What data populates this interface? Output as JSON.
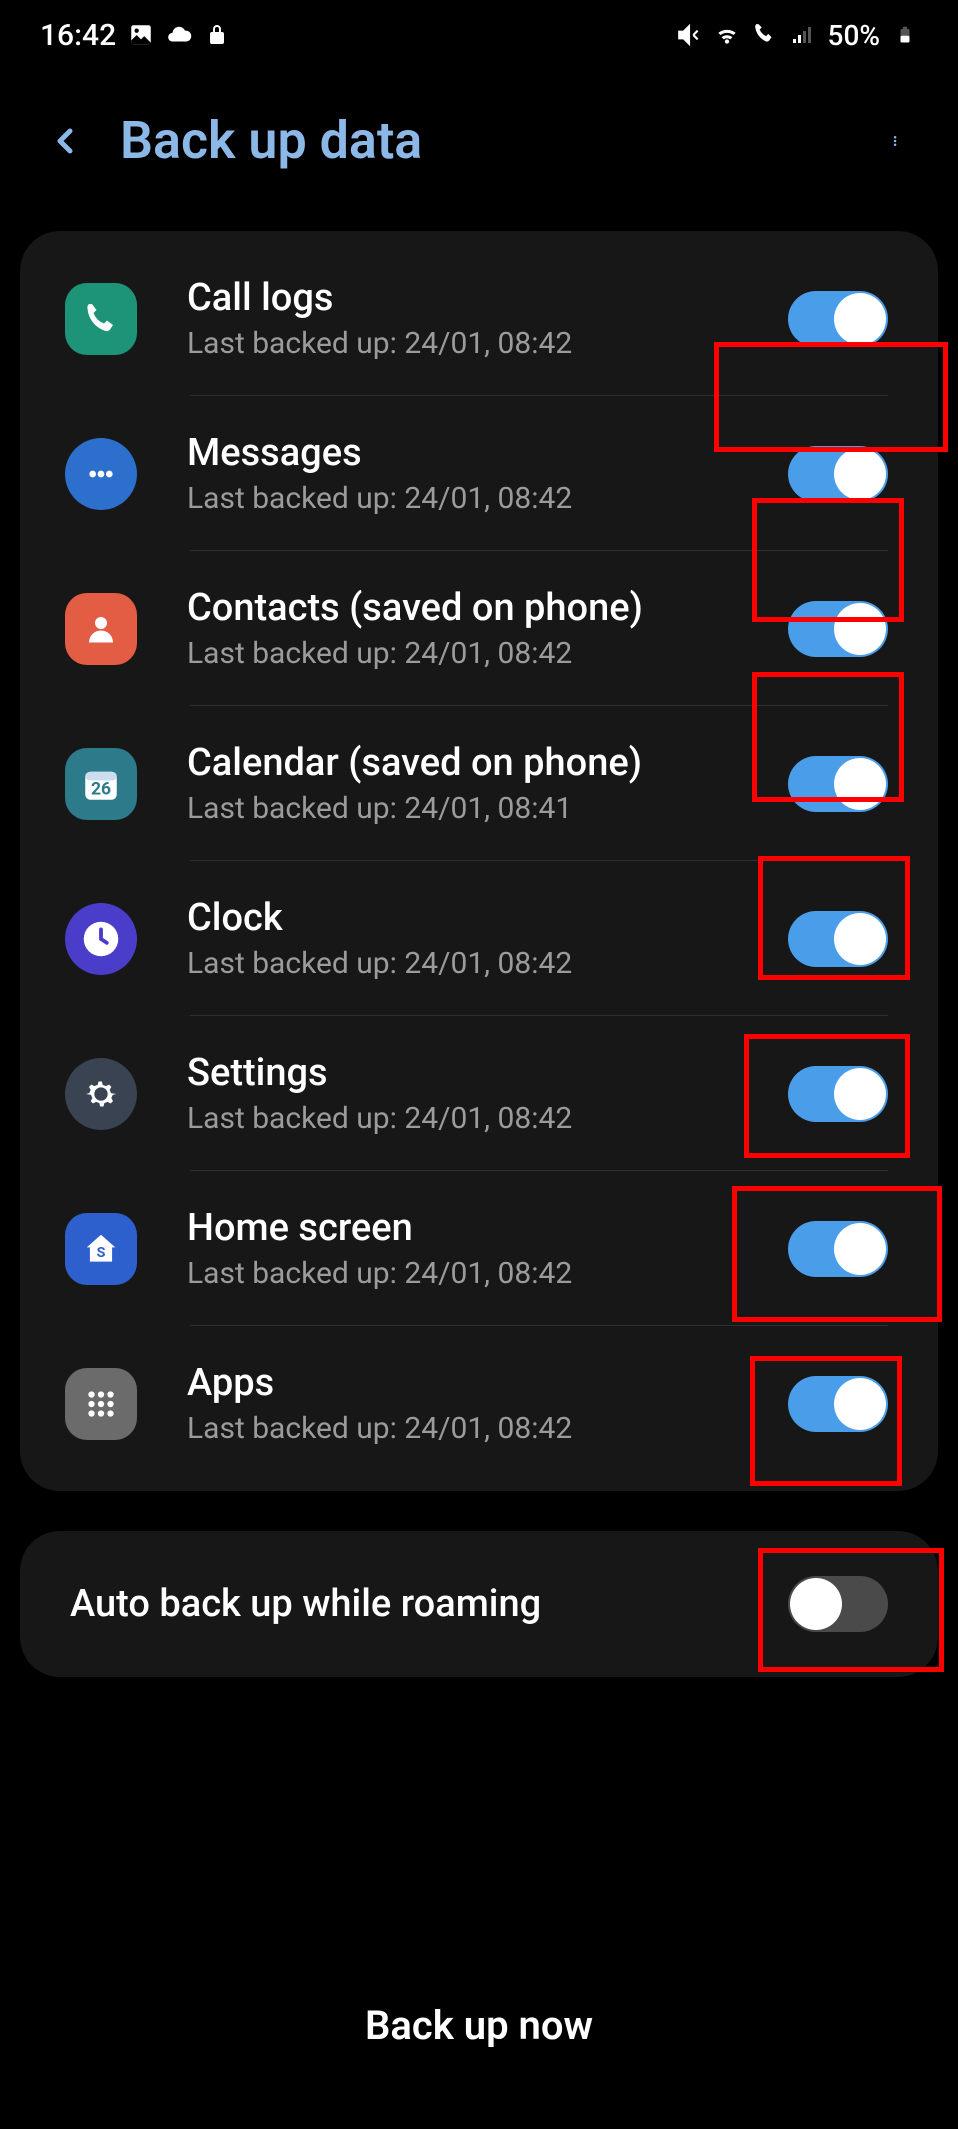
{
  "status": {
    "time": "16:42",
    "battery_percent": "50%"
  },
  "header": {
    "title": "Back up data"
  },
  "items": [
    {
      "title": "Call logs",
      "subtitle": "Last backed up: 24/01, 08:42",
      "icon": "phone",
      "toggle": true
    },
    {
      "title": "Messages",
      "subtitle": "Last backed up: 24/01, 08:42",
      "icon": "msg",
      "toggle": true
    },
    {
      "title": "Contacts (saved on phone)",
      "subtitle": "Last backed up: 24/01, 08:42",
      "icon": "contacts",
      "toggle": true
    },
    {
      "title": "Calendar (saved on phone)",
      "subtitle": "Last backed up: 24/01, 08:41",
      "icon": "cal",
      "toggle": true
    },
    {
      "title": "Clock",
      "subtitle": "Last backed up: 24/01, 08:42",
      "icon": "clock",
      "toggle": true
    },
    {
      "title": "Settings",
      "subtitle": "Last backed up: 24/01, 08:42",
      "icon": "settings",
      "toggle": true
    },
    {
      "title": "Home screen",
      "subtitle": "Last backed up: 24/01, 08:42",
      "icon": "home",
      "toggle": true
    },
    {
      "title": "Apps",
      "subtitle": "Last backed up: 24/01, 08:42",
      "icon": "apps",
      "toggle": true
    }
  ],
  "roaming": {
    "title": "Auto back up while roaming",
    "toggle": false
  },
  "footer": {
    "button": "Back up now"
  }
}
